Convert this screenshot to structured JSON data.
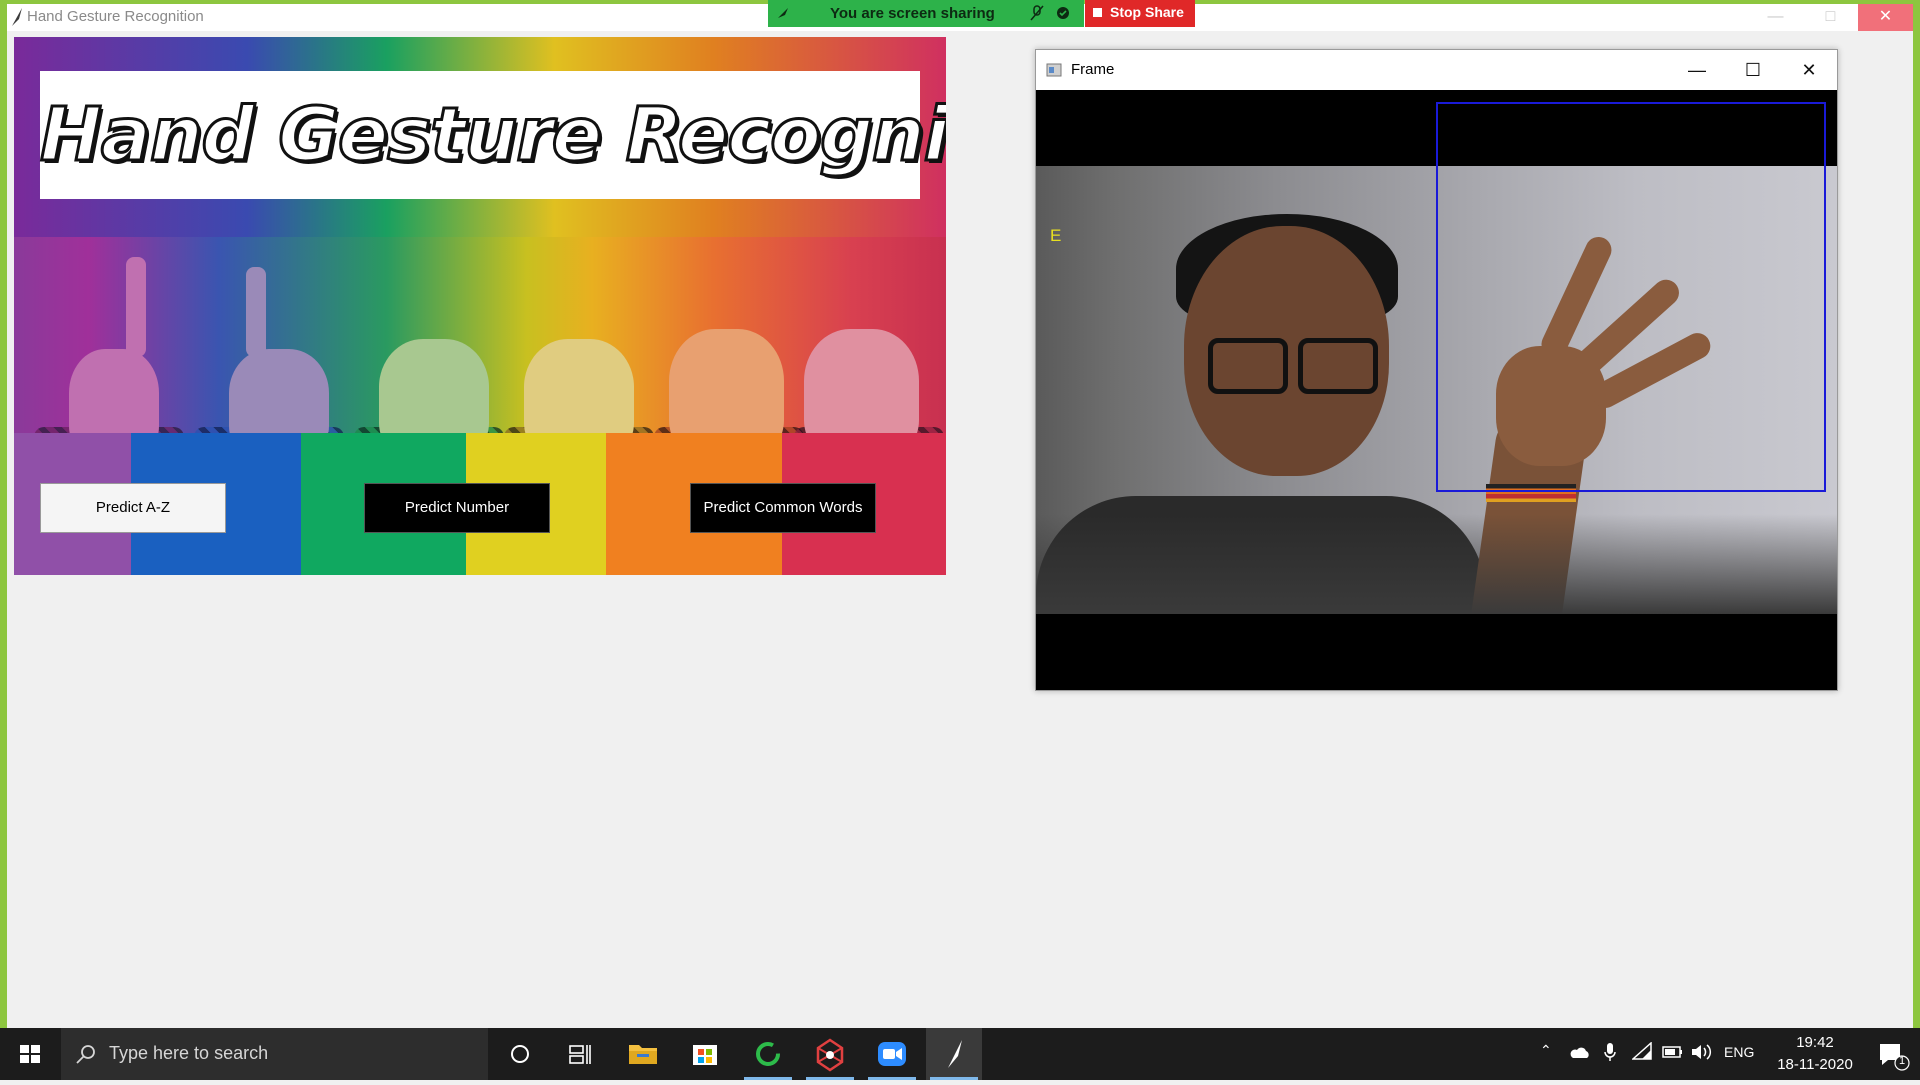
{
  "app": {
    "title": "Hand Gesture Recognition"
  },
  "share_bar": {
    "text": "You are screen sharing",
    "stop_label": "Stop Share",
    "color": "#2db24a",
    "stop_color": "#e02828"
  },
  "banner": {
    "title": "Hand Gesture Recognition",
    "buttons": {
      "predict_az": "Predict A-Z",
      "predict_number": "Predict Number",
      "predict_words": "Predict Common Words"
    }
  },
  "frame": {
    "title": "Frame",
    "predicted_letter": "E",
    "roi_color": "#1a1ad8"
  },
  "taskbar": {
    "search_placeholder": "Type here to search",
    "language": "ENG",
    "time": "19:42",
    "date": "18-11-2020",
    "notification_count": "1",
    "pinned": [
      "cortana-icon",
      "task-view-icon",
      "file-explorer-icon",
      "microsoft-store-icon",
      "spinner-app-icon",
      "network-app-icon",
      "zoom-icon",
      "feather-app-icon"
    ]
  }
}
